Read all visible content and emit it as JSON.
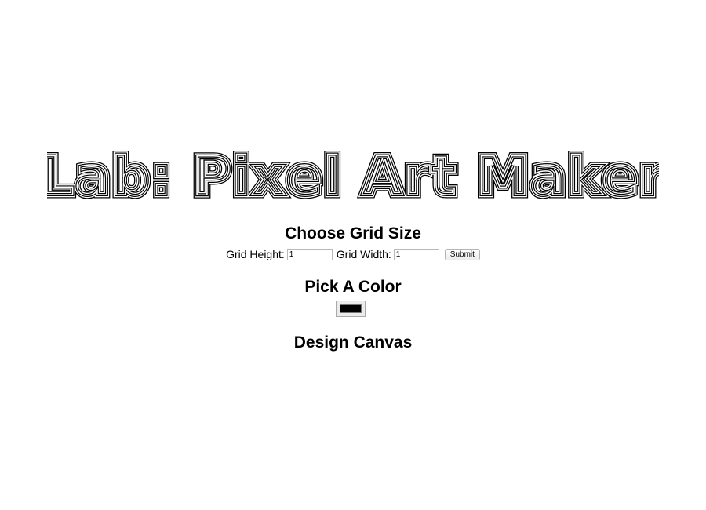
{
  "title": "Lab: Pixel Art Maker",
  "grid": {
    "heading": "Choose Grid Size",
    "height_label": "Grid Height:",
    "height_value": "1",
    "width_label": "Grid Width:",
    "width_value": "1",
    "submit_label": "Submit"
  },
  "color": {
    "heading": "Pick A Color",
    "value": "#000000"
  },
  "canvas": {
    "heading": "Design Canvas"
  }
}
